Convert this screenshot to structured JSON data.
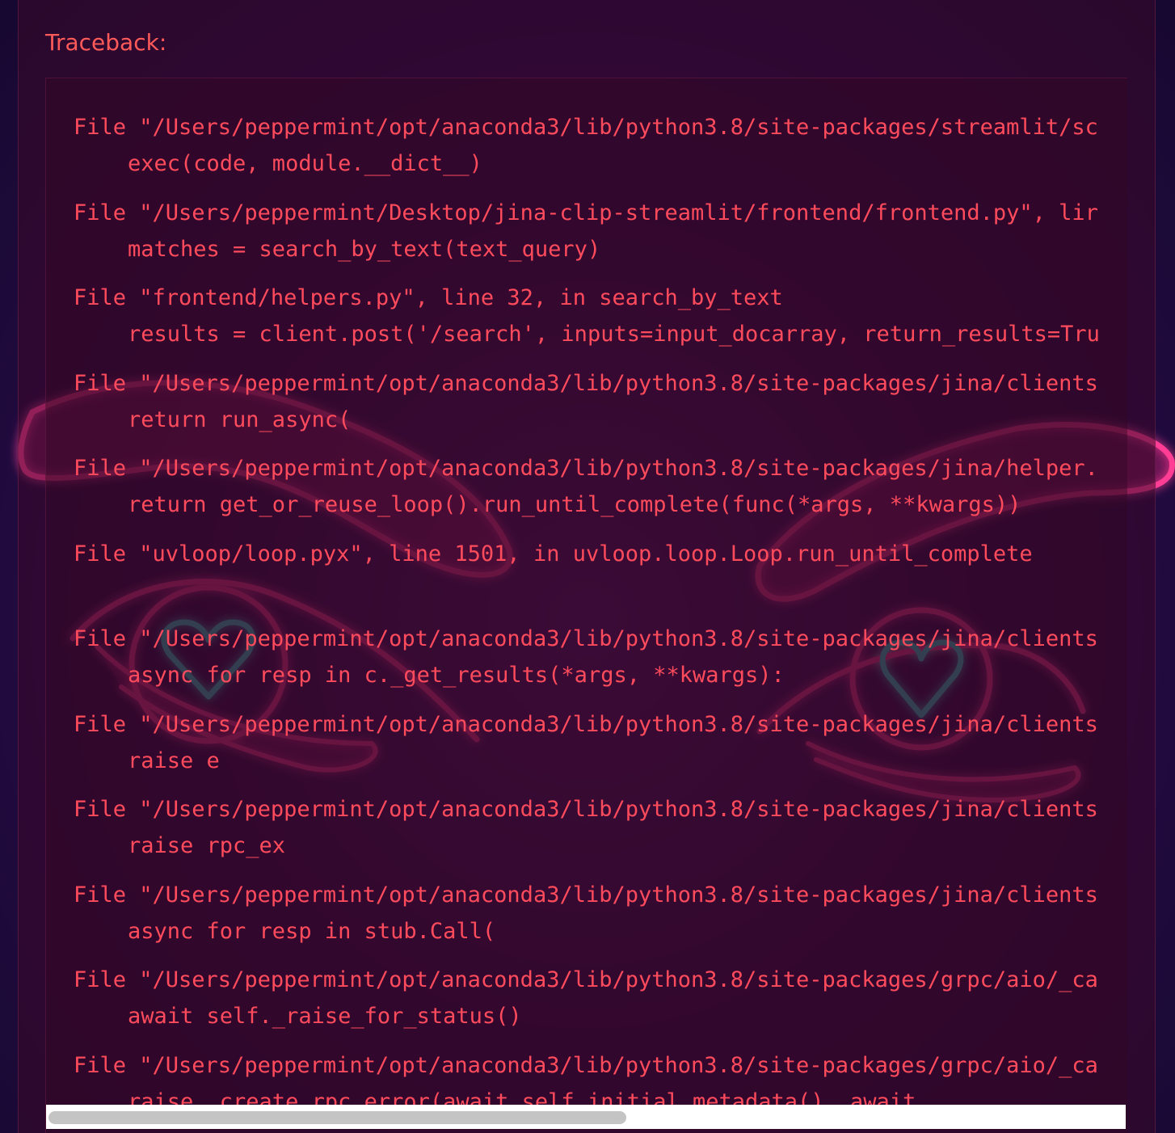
{
  "traceback": {
    "label": "Traceback:",
    "frames": [
      {
        "file": "File \"/Users/peppermint/opt/anaconda3/lib/python3.8/site-packages/streamlit/sc",
        "code": "exec(code, module.__dict__)"
      },
      {
        "file": "File \"/Users/peppermint/Desktop/jina-clip-streamlit/frontend/frontend.py\", lir",
        "code": "matches = search_by_text(text_query)"
      },
      {
        "file": "File \"frontend/helpers.py\", line 32, in search_by_text",
        "code": "results = client.post('/search', inputs=input_docarray, return_results=Tru"
      },
      {
        "file": "File \"/Users/peppermint/opt/anaconda3/lib/python3.8/site-packages/jina/clients",
        "code": "return run_async("
      },
      {
        "file": "File \"/Users/peppermint/opt/anaconda3/lib/python3.8/site-packages/jina/helper.",
        "code": "return get_or_reuse_loop().run_until_complete(func(*args, **kwargs))"
      },
      {
        "file": "File \"uvloop/loop.pyx\", line 1501, in uvloop.loop.Loop.run_until_complete",
        "code": ""
      },
      {
        "file": "File \"/Users/peppermint/opt/anaconda3/lib/python3.8/site-packages/jina/clients",
        "code": "async for resp in c._get_results(*args, **kwargs):"
      },
      {
        "file": "File \"/Users/peppermint/opt/anaconda3/lib/python3.8/site-packages/jina/clients",
        "code": "raise e"
      },
      {
        "file": "File \"/Users/peppermint/opt/anaconda3/lib/python3.8/site-packages/jina/clients",
        "code": "raise rpc_ex"
      },
      {
        "file": "File \"/Users/peppermint/opt/anaconda3/lib/python3.8/site-packages/jina/clients",
        "code": "async for resp in stub.Call("
      },
      {
        "file": "File \"/Users/peppermint/opt/anaconda3/lib/python3.8/site-packages/grpc/aio/_ca",
        "code": "await self._raise_for_status()"
      },
      {
        "file": "File \"/Users/peppermint/opt/anaconda3/lib/python3.8/site-packages/grpc/aio/_ca",
        "code": "raise _create_rpc_error(await self.initial_metadata(), await"
      }
    ]
  },
  "colors": {
    "error_text": "#ff4b5c",
    "background": "#2a0d4a",
    "neon_pink": "#ff2d8a",
    "neon_cyan": "#2ee6d6"
  },
  "icons": {
    "background_art": "neon-eyes-with-heart-pupils-icon"
  },
  "scrollbar": {
    "horizontal_position": 0.0
  }
}
